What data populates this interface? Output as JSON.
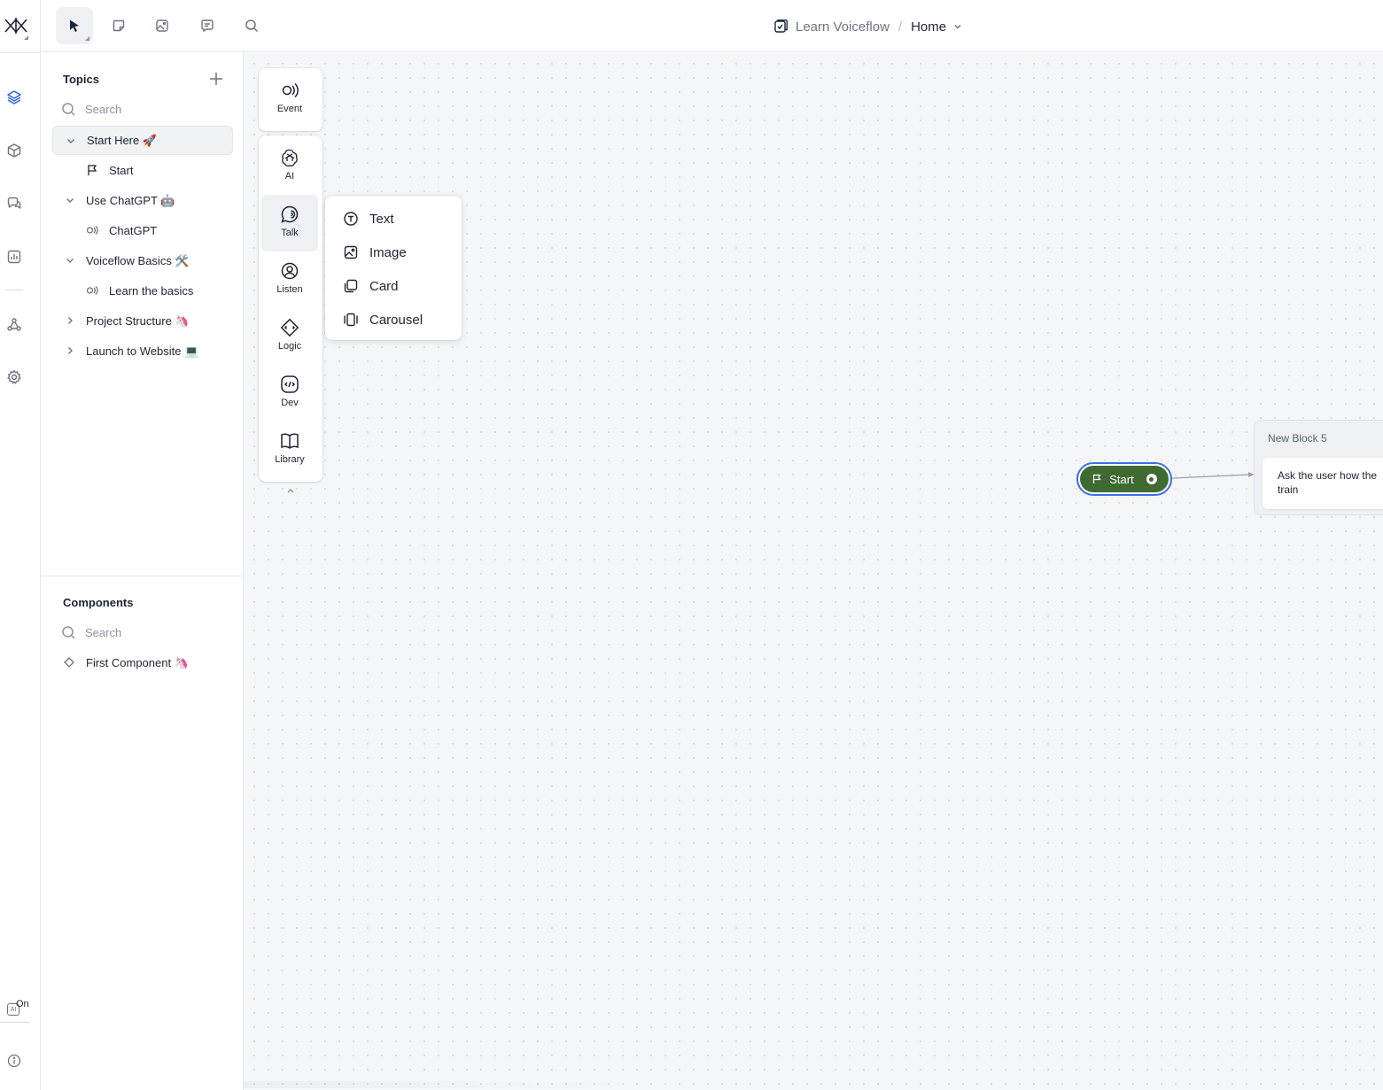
{
  "header": {
    "project_name": "Learn Voiceflow",
    "separator": "/",
    "page_name": "Home"
  },
  "panel": {
    "topics_title": "Topics",
    "topics_search_placeholder": "Search",
    "topics": [
      {
        "label": "Start Here 🚀",
        "expanded": true,
        "selected": true,
        "children": [
          {
            "label": "Start",
            "icon": "flag-icon"
          }
        ]
      },
      {
        "label": "Use ChatGPT 🤖",
        "expanded": true,
        "children": [
          {
            "label": "ChatGPT",
            "icon": "event-icon"
          }
        ]
      },
      {
        "label": "Voiceflow Basics 🛠️",
        "expanded": true,
        "children": [
          {
            "label": "Learn the basics",
            "icon": "event-icon"
          }
        ]
      },
      {
        "label": "Project Structure 🦄",
        "expanded": false
      },
      {
        "label": "Launch to Website 💻",
        "expanded": false
      }
    ],
    "components_title": "Components",
    "components_search_placeholder": "Search",
    "components": [
      {
        "label": "First Component 🦄",
        "icon": "component-icon"
      }
    ]
  },
  "steps": {
    "event": "Event",
    "ai": "AI",
    "talk": "Talk",
    "listen": "Listen",
    "logic": "Logic",
    "dev": "Dev",
    "library": "Library"
  },
  "talk_menu": {
    "items": [
      "Text",
      "Image",
      "Card",
      "Carousel"
    ]
  },
  "canvas": {
    "start_node_label": "Start",
    "block_title": "New Block 5",
    "block_text_line1": "Ask the user how the",
    "block_text_line2": "train"
  },
  "rail": {
    "ai_toggle_state": "On"
  },
  "colors": {
    "start_node": "#3f6b33",
    "selection_outline": "#3d6ee6",
    "canvas_background": "#f5f6f7"
  }
}
